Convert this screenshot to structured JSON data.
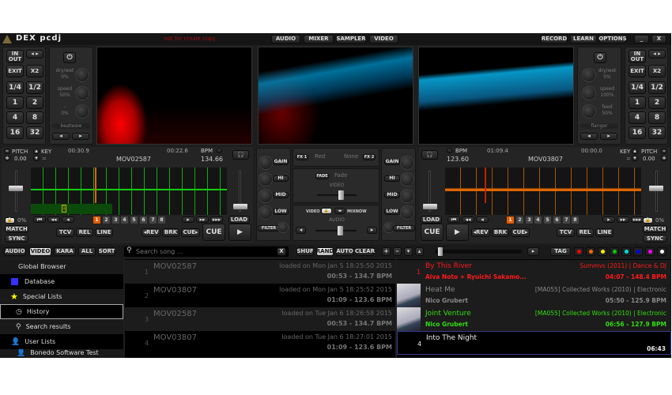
{
  "title_bar": {
    "logo": "DEX pcdj",
    "watermark": "not for resale copy",
    "tabs": [
      "AUDIO",
      "MIXER",
      "SAMPLER",
      "VIDEO"
    ],
    "right_buttons": [
      "RECORD",
      "LEARN",
      "OPTIONS"
    ],
    "minimize": "_",
    "close": "X"
  },
  "hotcue_grid": {
    "inout": "IN OUT",
    "exit": "EXIT",
    "x2": "X2",
    "sizes": [
      "1/4",
      "1/2",
      "1",
      "2",
      "4",
      "8",
      "16",
      "32"
    ],
    "arrows": "◂ ▸"
  },
  "fx_left": {
    "params": [
      {
        "name": "dry/wet",
        "value": "0%"
      },
      {
        "name": "speed",
        "value": "50%"
      },
      {
        "name": "-",
        "value": "0%"
      }
    ],
    "effect": "beatwaw"
  },
  "fx_right": {
    "params": [
      {
        "name": "dry/wet",
        "value": "0%"
      },
      {
        "name": "speed",
        "value": "100%"
      },
      {
        "name": "feed",
        "value": "50%"
      }
    ],
    "effect": "flanger"
  },
  "deck_left": {
    "pitch_label": "PITCH",
    "pitch": "0.00",
    "key_label": "KEY",
    "key": "=",
    "elapsed": "00:30.9",
    "remain": "00:22.6",
    "bpm_label": "BPM",
    "bpm": "134.66",
    "title": "MOV02587",
    "percent": "0%",
    "hotcues": [
      "1",
      "2",
      "3",
      "4",
      "5",
      "6",
      "7",
      "8"
    ],
    "load": "LOAD",
    "match": "MATCH",
    "sync": "SYNC",
    "modes": [
      "TCV",
      "REL",
      "LINE"
    ],
    "transport": [
      "◂REV",
      "BRK",
      "CUE▸"
    ],
    "cue": "CUE",
    "play": "▶",
    "marker": "1",
    "wave_color": "#22cc22"
  },
  "deck_right": {
    "pitch_label": "PITCH",
    "pitch": "0.00",
    "key_label": "KEY",
    "key": "=",
    "elapsed": "01:09.4",
    "remain": "00:00.0",
    "bpm_label": "BPM",
    "bpm": "123.60",
    "title": "MOV03807",
    "percent": "0%",
    "hotcues": [
      "1",
      "2",
      "3",
      "4",
      "5",
      "6",
      "7",
      "8"
    ],
    "load": "LOAD",
    "match": "MATCH",
    "sync": "SYNC",
    "modes": [
      "TCV",
      "REL",
      "LINE"
    ],
    "transport": [
      "◂REV",
      "BRK",
      "CUE▸"
    ],
    "cue": "CUE",
    "play": "▶",
    "wave_color": "#e07010"
  },
  "mixer": {
    "eq": [
      "GAIN",
      "HI",
      "MID",
      "LOW"
    ],
    "filter": "FILTER",
    "fx1_label": "FX 1",
    "fx1": "Red",
    "fx2_label": "FX 2",
    "fx2": "None",
    "fade_label": "FADE",
    "fade": "Fade",
    "video_label": "VIDEO",
    "audio_label": "AUDIO",
    "video_btn": "VIDEO",
    "mixnow": "MIXNOW",
    "video_xfader": 0.6,
    "audio_xfader": 0.6
  },
  "browser_toolbar": {
    "filters": [
      "AUDIO",
      "VIDEO",
      "KARA",
      "ALL",
      "SORT"
    ],
    "active_filter": "VIDEO",
    "search_placeholder": "Search song ...",
    "clear": "X",
    "playlist_buttons": [
      "SHUF",
      "RAND",
      "AUTO",
      "CLEAR"
    ],
    "active_playlist_button": "RAND",
    "list_buttons": [
      "+",
      "–",
      "▾",
      "▴"
    ],
    "play": "▸",
    "tag": "TAG",
    "tag_colors": [
      "#ff0000",
      "#ff6600",
      "#ffee00",
      "#00cc00",
      "#00dddd",
      "#0000ff",
      "#ff00ff",
      "#ffffff"
    ]
  },
  "sidebar": {
    "items": [
      {
        "label": "Global Browser",
        "icon": "none"
      },
      {
        "label": "Database",
        "icon": "database-icon"
      },
      {
        "label": "Special Lists",
        "icon": "star-icon"
      },
      {
        "label": "History",
        "icon": "clock-icon",
        "selected": true
      },
      {
        "label": "Search results",
        "icon": "search-icon"
      },
      {
        "label": "User Lists",
        "icon": "user-icon"
      },
      {
        "label": "Bonedo Software Test",
        "icon": "user-icon"
      }
    ]
  },
  "history": [
    {
      "num": "1",
      "title": "MOV02587",
      "loaded": "loaded on Mon Jan  5 18:25:50 2015",
      "info": "00:53 - 134.7 BPM"
    },
    {
      "num": "2",
      "title": "MOV03807",
      "loaded": "loaded on Mon Jan  5 18:25:52 2015",
      "info": "01:09 - 123.6 BPM"
    },
    {
      "num": "3",
      "title": "MOV02587",
      "loaded": "loaded on Tue Jan  6 18:26:58 2015",
      "info": "00:53 - 134.7 BPM"
    },
    {
      "num": "4",
      "title": "MOV03807",
      "loaded": "loaded on Tue Jan  6 18:27:01 2015",
      "info": "01:09 - 123.6 BPM"
    }
  ],
  "playlist": [
    {
      "num": "1",
      "title": "By This River",
      "artist": "Alva Noto + Ryuichi Sakamo...",
      "album": "Summvs (2011) | Dance & DJ",
      "info": "04:07 - 148.4 BPM",
      "color": "#ff1a1a",
      "art": false
    },
    {
      "num": "",
      "title": "Heat Me",
      "artist": "Nico Grubert",
      "album": "[MA055] Collected Works (2010) | Electronic",
      "info": "05:50 - 125.9 BPM",
      "color": "#888888",
      "art": true
    },
    {
      "num": "",
      "title": "Joint Venture",
      "artist": "Nico Grubert",
      "album": "[MA055] Collected Works (2010) | Electronic",
      "info": "06:56 - 127.9 BPM",
      "color": "#33dd11",
      "art": true
    },
    {
      "num": "4",
      "title": "Into The Night",
      "artist": "",
      "album": "",
      "info": "06:43",
      "color": "#eeeeee",
      "art": false
    }
  ]
}
